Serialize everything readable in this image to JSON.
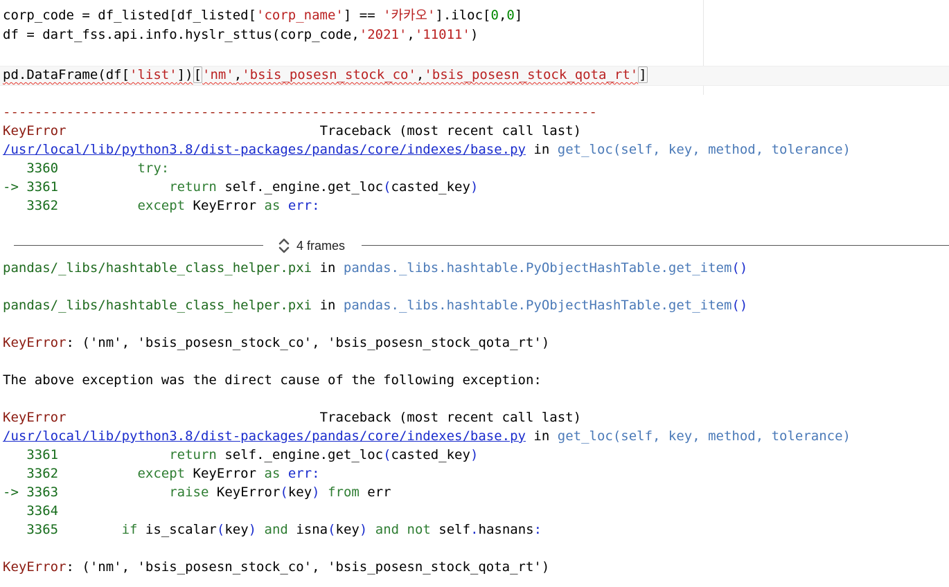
{
  "code_cell": {
    "line1": {
      "a": "corp_code = df_listed[df_listed[",
      "b": "'corp_name'",
      "c": "] == ",
      "d": "'카카오'",
      "e": "].iloc[",
      "f": "0",
      "g": ",",
      "h": "0",
      "i": "]"
    },
    "line2": {
      "a": "df = dart_fss.api.info.hyslr_sttus(corp_code,",
      "b": "'2021'",
      "c": ",",
      "d": "'11011'",
      "e": ")"
    },
    "line4": {
      "a": "pd.DataFrame(df[",
      "b": "'list'",
      "c": "])",
      "d": "[",
      "e": "'nm'",
      "f": ",",
      "g": "'bsis_posesn_stock_co'",
      "h": ",",
      "i": "'bsis_posesn_stock_qota_rt'",
      "j": "]"
    }
  },
  "output": {
    "dashes": "---------------------------------------------------------------------------",
    "tb1": {
      "error_name": "KeyError",
      "traceback_label": "Traceback (most recent call last)",
      "path": "/usr/local/lib/python3.8/dist-packages/pandas/core/indexes/base.py",
      "in_word": " in ",
      "func": "get_loc",
      "args": "(self, key, method, tolerance)",
      "l1_no": "   3360",
      "l1_code": "try:",
      "l2_no": "-> 3361",
      "l2_a": "return",
      "l2_b": " self._engine.get_loc",
      "l2_c": "(",
      "l2_d": "casted_key",
      "l2_e": ")",
      "l3_no": "   3362",
      "l3_a": "except",
      "l3_b": " KeyError ",
      "l3_c": "as",
      "l3_d": " err:"
    },
    "frames_label": "4 frames",
    "pxi_file": "pandas/_libs/hashtable_class_helper.pxi",
    "pxi_in": " in ",
    "pxi_func": "pandas._libs.hashtable.PyObjectHashTable.get_item",
    "pxi_paren": "()",
    "keyerror_msg_name": "KeyError",
    "keyerror_msg_text": ": ('nm', 'bsis_posesn_stock_co', 'bsis_posesn_stock_qota_rt')",
    "cause_text": "The above exception was the direct cause of the following exception:",
    "tb2": {
      "m1_no": "   3361",
      "m1_a": "return",
      "m1_b": " self._engine.get_loc",
      "m1_c": "(",
      "m1_d": "casted_key",
      "m1_e": ")",
      "m2_no": "   3362",
      "m2_a": "except",
      "m2_b": " KeyError ",
      "m2_c": "as",
      "m2_d": " err:",
      "m3_no": "-> 3363",
      "m3_a": "raise",
      "m3_b": " KeyError",
      "m3_c": "(",
      "m3_d": "key",
      "m3_e": ") ",
      "m3_f": "from",
      "m3_g": " err",
      "m4_no": "   3364",
      "m5_no": "   3365",
      "m5_a": "if",
      "m5_b": " is_scalar",
      "m5_c": "(",
      "m5_d": "key",
      "m5_e": ") ",
      "m5_f": "and",
      "m5_g": " isna",
      "m5_h": "(",
      "m5_i": "key",
      "m5_j": ") ",
      "m5_k": "and",
      "m5_l": " ",
      "m5_m": "not",
      "m5_n": " self",
      "m5_o": ".",
      "m5_p": "hasnans",
      "m5_q": ":"
    }
  },
  "icons": {
    "frames_toggle": "chevron-up-down-icon"
  }
}
